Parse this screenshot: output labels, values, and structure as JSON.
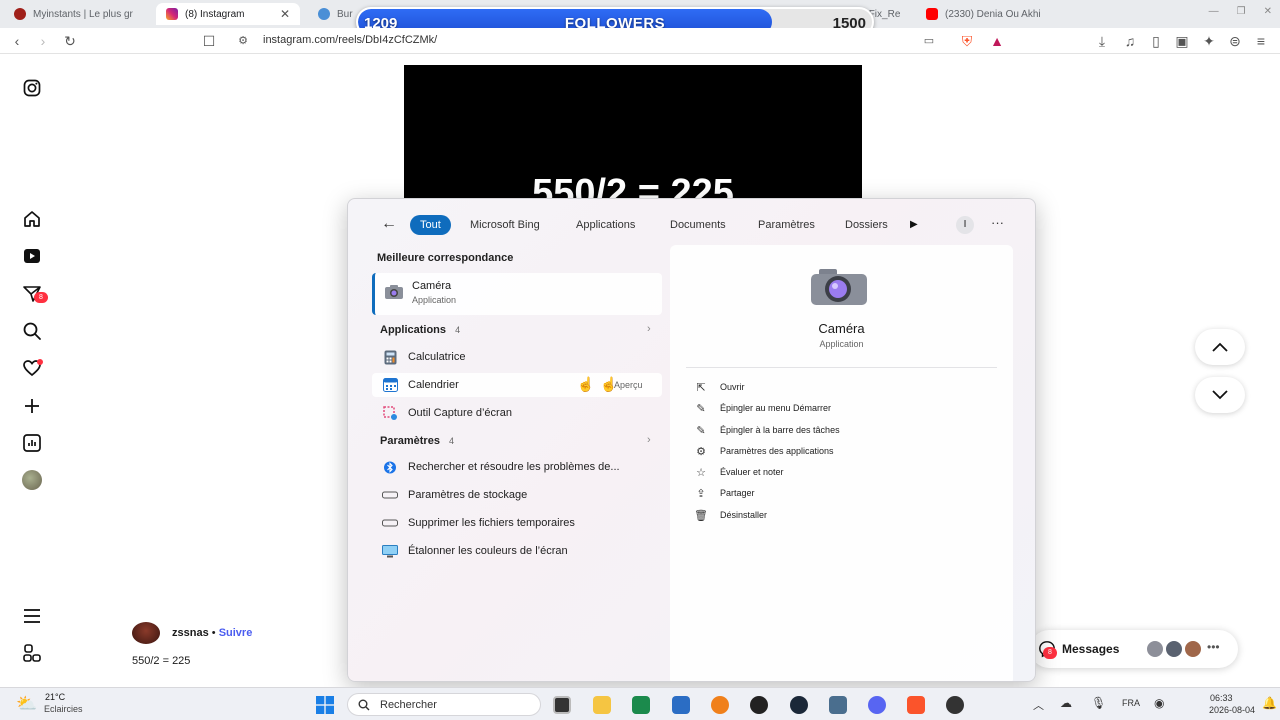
{
  "browser": {
    "tabs": [
      {
        "title": "Myinstants | Le plus gr",
        "icon": "myinstants-icon",
        "color": "#a0201a"
      },
      {
        "title": "(8) Instagram",
        "icon": "instagram-icon",
        "color": "#d62976",
        "active": true
      },
      {
        "title": "Bur",
        "icon": "globe-icon",
        "color": "#4a8fd6"
      },
      {
        "title": "BurglinGnomes Fix_Re",
        "icon": "steam-icon",
        "color": "#333333"
      },
      {
        "title": "(2330) Denia Ou Akhi",
        "icon": "youtube-icon",
        "color": "#ff0000"
      }
    ],
    "url": "instagram.com/reels/DbI4zCfCZMk/"
  },
  "followers": {
    "current": "1209",
    "label": "FOLLOWERS",
    "goal": "1500",
    "progress": 0.806
  },
  "reel": {
    "text": "550/2 = 225"
  },
  "post": {
    "username": "zssnas",
    "separator": "•",
    "follow": "Suivre",
    "caption": "550/2 = 225"
  },
  "sidebar": {
    "notification_badge": "8"
  },
  "search": {
    "chips": [
      "Tout",
      "Microsoft Bing",
      "Applications",
      "Documents",
      "Paramètres",
      "Dossiers"
    ],
    "more": "I",
    "best_match_title": "Meilleure correspondance",
    "best_match": {
      "name": "Caméra",
      "type": "Application"
    },
    "apps_title": "Applications",
    "apps_count": "4",
    "apps": [
      "Calculatrice",
      "Calendrier",
      "Outil Capture d’écran"
    ],
    "preview_label": "Aperçu",
    "settings_title": "Paramètres",
    "settings_count": "4",
    "settings": [
      "Rechercher et résoudre les problèmes de...",
      "Paramètres de stockage",
      "Supprimer les fichiers temporaires",
      "Étalonner les couleurs de l’écran"
    ],
    "detail": {
      "name": "Caméra",
      "type": "Application",
      "actions": [
        "Ouvrir",
        "Épingler au menu Démarrer",
        "Épingler à la barre des tâches",
        "Paramètres des applications",
        "Évaluer et noter",
        "Partager",
        "Désinstaller"
      ]
    }
  },
  "messages": {
    "label": "Messages",
    "badge": "8"
  },
  "taskbar": {
    "weather_temp": "21°C",
    "weather_desc": "Eclaircies",
    "search_placeholder": "Rechercher",
    "language": "FRA",
    "time": "06:33",
    "date": "2026-08-04"
  },
  "colors": {
    "accent": "#0f6cbd",
    "followers_bar": "#2f6cf5"
  }
}
